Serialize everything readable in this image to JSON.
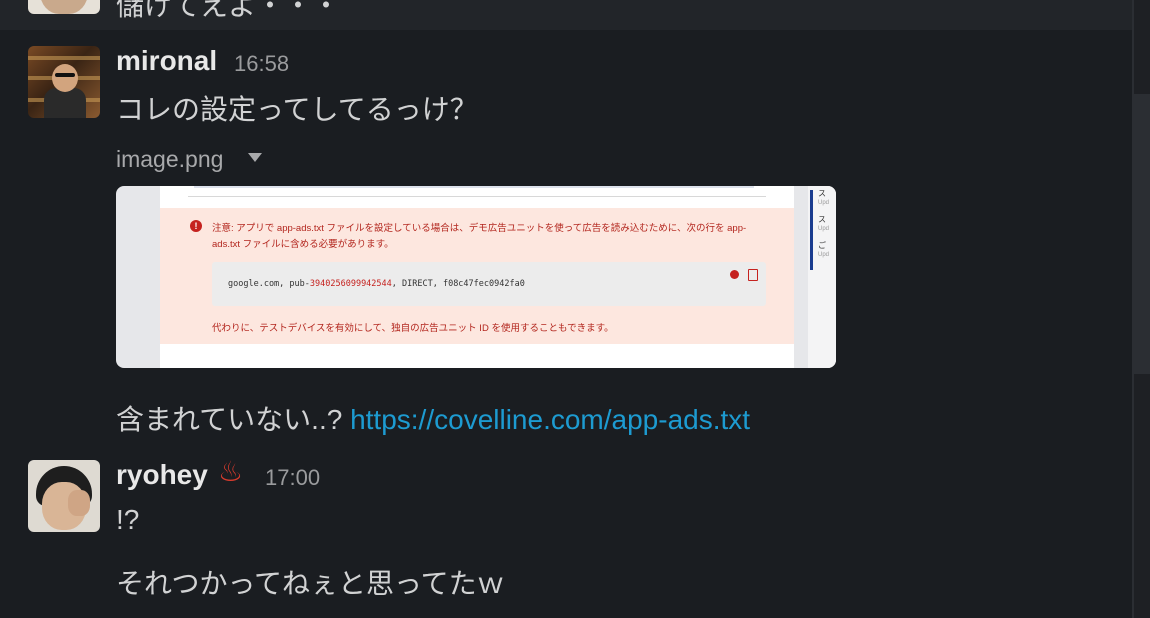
{
  "previous": {
    "text": "儲けてえよ・・・"
  },
  "messages": [
    {
      "author": "mironal",
      "time": "16:58",
      "lines": [
        "コレの設定ってしてるっけ？"
      ],
      "file": {
        "name": "image.png",
        "preview": {
          "note_line1": "注意: アプリで app-ads.txt ファイルを設定している場合は、デモ広告ユニットを使って広告を読み込むために、次の行を app-",
          "note_line2": "ads.txt ファイルに含める必要があります。",
          "code_prefix": "google.com, pub-",
          "code_number": "3940256099942544",
          "code_suffix": ", DIRECT, f08c47fec0942fa0",
          "note_line3": "代わりに、テストデバイスを有効にして、独自の広告ユニット ID を使用することもできます。",
          "side_items": [
            {
              "title": "ス",
              "sub": "Upd"
            },
            {
              "title": "ス",
              "sub": "Upd"
            },
            {
              "title": "ご",
              "sub": "Upd"
            }
          ]
        }
      },
      "followup": {
        "text": "含まれていない..? ",
        "link": "https://covelline.com/app-ads.txt"
      }
    },
    {
      "author": "ryohey",
      "emoji": "♨",
      "time": "17:00",
      "lines": [
        "!?",
        "それつかってねぇと思ってたｗ"
      ]
    }
  ],
  "colors": {
    "background": "#1a1d21",
    "text": "#d1d2d3",
    "link": "#1d9bd1",
    "timestamp": "#9a9b9d",
    "hot_springs_emoji": "#d83b2d"
  }
}
